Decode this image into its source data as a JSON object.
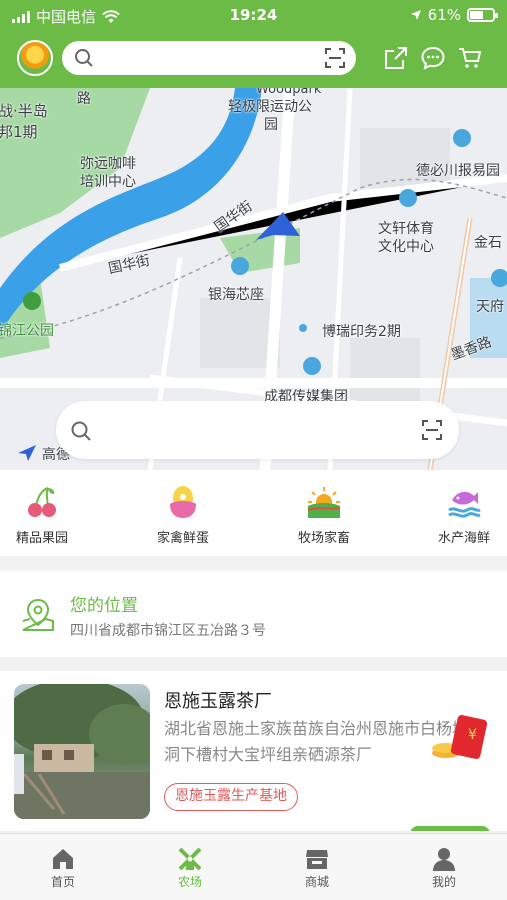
{
  "status_bar": {
    "carrier": "中国电信",
    "time": "19:24",
    "battery_percent_label": "61%",
    "battery_level": 0.61
  },
  "header": {
    "search_placeholder": "",
    "icons": [
      "search-icon",
      "scan-icon",
      "share-icon",
      "message-icon",
      "cart-icon"
    ]
  },
  "map": {
    "labels": [
      "Woodpark",
      "轻极限运动公",
      "园",
      "战·半岛",
      "邦1期",
      "路",
      "弥远咖啡",
      "培训中心",
      "德必川报易园",
      "国华街",
      "文轩体育",
      "文化中心",
      "金石",
      "国华街",
      "银海芯座",
      "天府",
      "锦江公园",
      "博瑞印务2期",
      "墨香路",
      "成都传媒集团",
      "高德"
    ],
    "search_placeholder": ""
  },
  "categories": [
    {
      "label": "精品果园",
      "icon": "cherry-icon"
    },
    {
      "label": "家禽鲜蛋",
      "icon": "egg-icon"
    },
    {
      "label": "牧场家畜",
      "icon": "sunrise-field-icon"
    },
    {
      "label": "水产海鲜",
      "icon": "fish-icon"
    }
  ],
  "location": {
    "title": "您的位置",
    "address": "四川省成都市锦江区五冶路３号"
  },
  "farm": {
    "name": "恩施玉露茶厂",
    "address": "湖北省恩施土家族苗族自治州恩施市白杨坪乡洞下槽村大宝坪组亲硒源茶厂",
    "tag": "恩施玉露生产基地",
    "redpack_symbol": "¥"
  },
  "tabs": [
    {
      "label": "首页",
      "icon": "home-icon",
      "active": false
    },
    {
      "label": "农场",
      "icon": "windmill-icon",
      "active": true
    },
    {
      "label": "商城",
      "icon": "store-icon",
      "active": false
    },
    {
      "label": "我的",
      "icon": "user-icon",
      "active": false
    }
  ],
  "colors": {
    "brand_green": "#6cbb46",
    "tag_red": "#e25b5b",
    "water_blue": "#3aa0e8"
  }
}
